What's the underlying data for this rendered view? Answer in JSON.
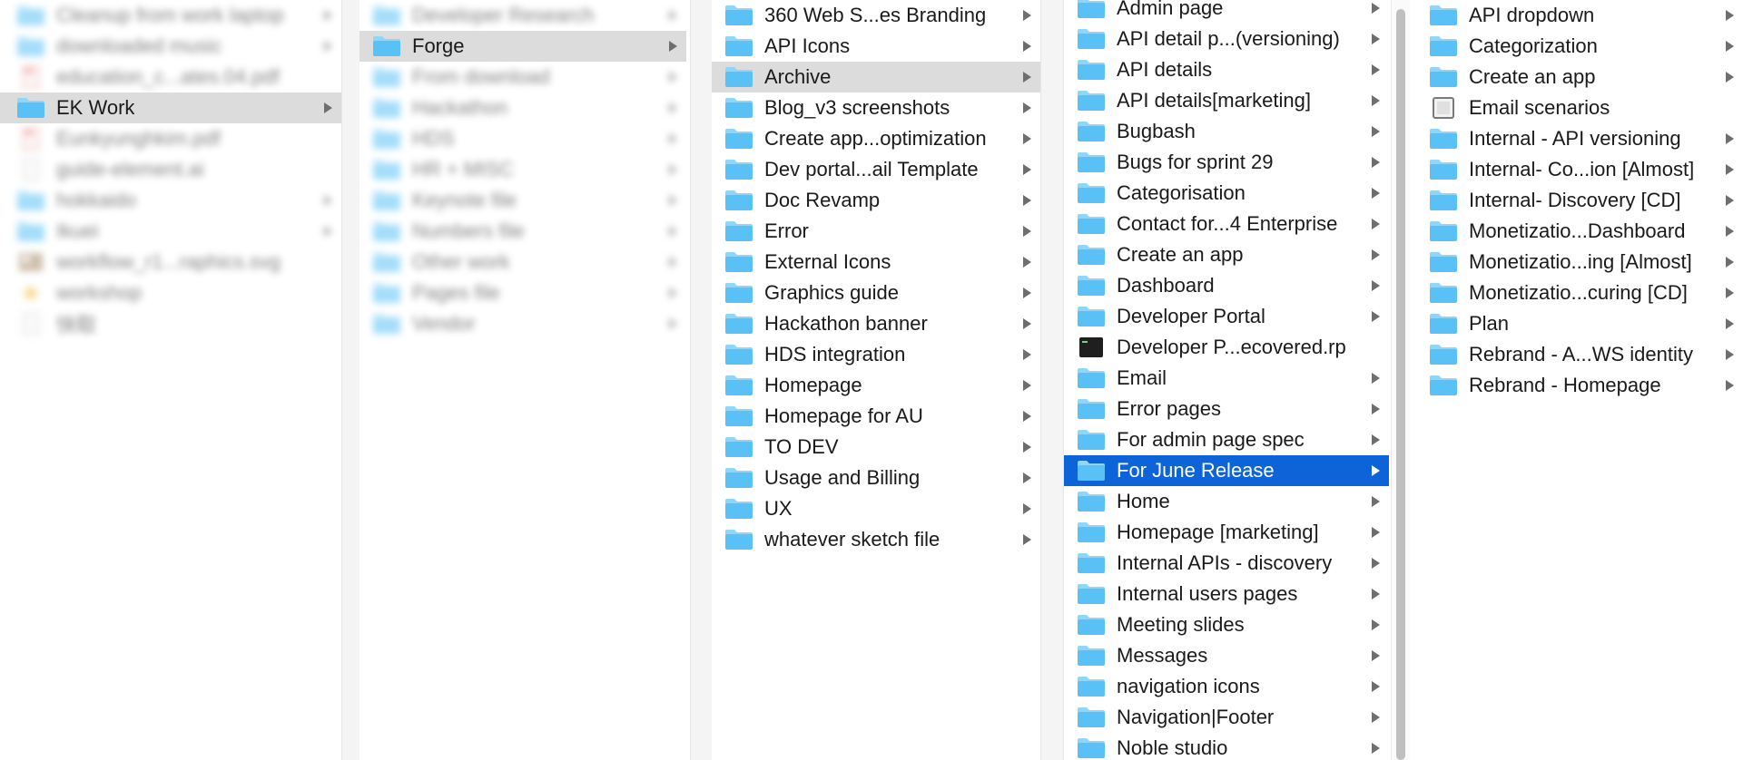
{
  "window": {
    "column1": {
      "items": [
        {
          "label": "Cleanup from work laptop",
          "icon": "folder-icon",
          "has_arrow": true,
          "state": "blur"
        },
        {
          "label": "downloaded music",
          "icon": "folder-icon",
          "has_arrow": true,
          "state": "blur"
        },
        {
          "label": "education_c...ates.04.pdf",
          "icon": "pdf-icon",
          "has_arrow": false,
          "state": "blur"
        },
        {
          "label": "EK Work",
          "icon": "folder-icon",
          "has_arrow": true,
          "state": "selected-gray"
        },
        {
          "label": "Eunkyunghkim.pdf",
          "icon": "pdf-icon",
          "has_arrow": false,
          "state": "blur"
        },
        {
          "label": "guide-element.ai",
          "icon": "doc-icon",
          "has_arrow": false,
          "state": "blur"
        },
        {
          "label": "hokkaido",
          "icon": "folder-icon",
          "has_arrow": true,
          "state": "blur"
        },
        {
          "label": "Ikuei",
          "icon": "folder-icon",
          "has_arrow": true,
          "state": "blur"
        },
        {
          "label": "workflow_r1...raphics.svg",
          "icon": "image-icon",
          "has_arrow": false,
          "state": "blur"
        },
        {
          "label": "workshop",
          "icon": "star-icon",
          "has_arrow": false,
          "state": "blur"
        },
        {
          "label": "快取",
          "icon": "doc-icon",
          "has_arrow": false,
          "state": "blur"
        }
      ]
    },
    "column2": {
      "items": [
        {
          "label": "Developer Research",
          "icon": "folder-icon",
          "has_arrow": true,
          "state": "blur"
        },
        {
          "label": "Forge",
          "icon": "folder-icon",
          "has_arrow": true,
          "state": "selected-gray"
        },
        {
          "label": "From download",
          "icon": "folder-icon",
          "has_arrow": true,
          "state": "blur"
        },
        {
          "label": "Hackathon",
          "icon": "folder-icon",
          "has_arrow": true,
          "state": "blur"
        },
        {
          "label": "HDS",
          "icon": "folder-icon",
          "has_arrow": true,
          "state": "blur"
        },
        {
          "label": "HR + MISC",
          "icon": "folder-icon",
          "has_arrow": true,
          "state": "blur"
        },
        {
          "label": "Keynote file",
          "icon": "folder-icon",
          "has_arrow": true,
          "state": "blur"
        },
        {
          "label": "Numbers file",
          "icon": "folder-icon",
          "has_arrow": true,
          "state": "blur"
        },
        {
          "label": "Other work",
          "icon": "folder-icon",
          "has_arrow": true,
          "state": "blur"
        },
        {
          "label": "Pages file",
          "icon": "folder-icon",
          "has_arrow": true,
          "state": "blur"
        },
        {
          "label": "Vendor",
          "icon": "folder-icon",
          "has_arrow": true,
          "state": "blur"
        }
      ]
    },
    "column3": {
      "items": [
        {
          "label": "360 Web S...es Branding",
          "icon": "folder-icon",
          "has_arrow": true,
          "state": "normal"
        },
        {
          "label": "API Icons",
          "icon": "folder-icon",
          "has_arrow": true,
          "state": "normal"
        },
        {
          "label": "Archive",
          "icon": "folder-icon",
          "has_arrow": true,
          "state": "selected-gray"
        },
        {
          "label": "Blog_v3 screenshots",
          "icon": "folder-icon",
          "has_arrow": true,
          "state": "normal"
        },
        {
          "label": "Create app...optimization",
          "icon": "folder-icon",
          "has_arrow": true,
          "state": "normal"
        },
        {
          "label": "Dev portal...ail Template",
          "icon": "folder-icon",
          "has_arrow": true,
          "state": "normal"
        },
        {
          "label": "Doc Revamp",
          "icon": "folder-icon",
          "has_arrow": true,
          "state": "normal"
        },
        {
          "label": "Error",
          "icon": "folder-icon",
          "has_arrow": true,
          "state": "normal"
        },
        {
          "label": "External Icons",
          "icon": "folder-icon",
          "has_arrow": true,
          "state": "normal"
        },
        {
          "label": "Graphics guide",
          "icon": "folder-icon",
          "has_arrow": true,
          "state": "normal"
        },
        {
          "label": "Hackathon banner",
          "icon": "folder-icon",
          "has_arrow": true,
          "state": "normal"
        },
        {
          "label": "HDS integration",
          "icon": "folder-icon",
          "has_arrow": true,
          "state": "normal"
        },
        {
          "label": "Homepage",
          "icon": "folder-icon",
          "has_arrow": true,
          "state": "normal"
        },
        {
          "label": "Homepage for AU",
          "icon": "folder-icon",
          "has_arrow": true,
          "state": "normal"
        },
        {
          "label": "TO DEV",
          "icon": "folder-icon",
          "has_arrow": true,
          "state": "normal"
        },
        {
          "label": "Usage and Billing",
          "icon": "folder-icon",
          "has_arrow": true,
          "state": "normal"
        },
        {
          "label": "UX",
          "icon": "folder-icon",
          "has_arrow": true,
          "state": "normal"
        },
        {
          "label": "whatever sketch file",
          "icon": "folder-icon",
          "has_arrow": true,
          "state": "normal"
        }
      ]
    },
    "column4": {
      "items": [
        {
          "label": "Admin page",
          "icon": "folder-icon",
          "has_arrow": true,
          "state": "normal"
        },
        {
          "label": "API detail p...(versioning)",
          "icon": "folder-icon",
          "has_arrow": true,
          "state": "normal"
        },
        {
          "label": "API details",
          "icon": "folder-icon",
          "has_arrow": true,
          "state": "normal"
        },
        {
          "label": "API details[marketing]",
          "icon": "folder-icon",
          "has_arrow": true,
          "state": "normal"
        },
        {
          "label": "Bugbash",
          "icon": "folder-icon",
          "has_arrow": true,
          "state": "normal"
        },
        {
          "label": "Bugs for sprint 29",
          "icon": "folder-icon",
          "has_arrow": true,
          "state": "normal"
        },
        {
          "label": "Categorisation",
          "icon": "folder-icon",
          "has_arrow": true,
          "state": "normal"
        },
        {
          "label": "Contact for...4 Enterprise",
          "icon": "folder-icon",
          "has_arrow": true,
          "state": "normal"
        },
        {
          "label": "Create an app",
          "icon": "folder-icon",
          "has_arrow": true,
          "state": "normal"
        },
        {
          "label": "Dashboard",
          "icon": "folder-icon",
          "has_arrow": true,
          "state": "normal"
        },
        {
          "label": "Developer Portal",
          "icon": "folder-icon",
          "has_arrow": true,
          "state": "normal"
        },
        {
          "label": "Developer P...ecovered.rp",
          "icon": "terminal-icon",
          "has_arrow": false,
          "state": "normal"
        },
        {
          "label": "Email",
          "icon": "folder-icon",
          "has_arrow": true,
          "state": "normal"
        },
        {
          "label": "Error pages",
          "icon": "folder-icon",
          "has_arrow": true,
          "state": "normal"
        },
        {
          "label": "For admin page spec",
          "icon": "folder-icon",
          "has_arrow": true,
          "state": "normal"
        },
        {
          "label": "For June Release",
          "icon": "folder-icon",
          "has_arrow": true,
          "state": "selected-blue"
        },
        {
          "label": "Home",
          "icon": "folder-icon",
          "has_arrow": true,
          "state": "normal"
        },
        {
          "label": "Homepage [marketing]",
          "icon": "folder-icon",
          "has_arrow": true,
          "state": "normal"
        },
        {
          "label": "Internal APIs - discovery",
          "icon": "folder-icon",
          "has_arrow": true,
          "state": "normal"
        },
        {
          "label": "Internal users pages",
          "icon": "folder-icon",
          "has_arrow": true,
          "state": "normal"
        },
        {
          "label": "Meeting slides",
          "icon": "folder-icon",
          "has_arrow": true,
          "state": "normal"
        },
        {
          "label": "Messages",
          "icon": "folder-icon",
          "has_arrow": true,
          "state": "normal"
        },
        {
          "label": "navigation icons",
          "icon": "folder-icon",
          "has_arrow": true,
          "state": "normal"
        },
        {
          "label": "Navigation|Footer",
          "icon": "folder-icon",
          "has_arrow": true,
          "state": "normal"
        },
        {
          "label": "Noble studio",
          "icon": "folder-icon",
          "has_arrow": true,
          "state": "normal"
        }
      ]
    },
    "column5": {
      "items": [
        {
          "label": "API dropdown",
          "icon": "folder-icon",
          "has_arrow": true,
          "state": "normal"
        },
        {
          "label": "Categorization",
          "icon": "folder-icon",
          "has_arrow": true,
          "state": "normal"
        },
        {
          "label": "Create an app",
          "icon": "folder-icon",
          "has_arrow": true,
          "state": "normal"
        },
        {
          "label": "Email scenarios",
          "icon": "file-icon",
          "has_arrow": false,
          "state": "normal"
        },
        {
          "label": "Internal - API versioning",
          "icon": "folder-icon",
          "has_arrow": true,
          "state": "normal"
        },
        {
          "label": "Internal- Co...ion [Almost]",
          "icon": "folder-icon",
          "has_arrow": true,
          "state": "normal"
        },
        {
          "label": "Internal- Discovery [CD]",
          "icon": "folder-icon",
          "has_arrow": true,
          "state": "normal"
        },
        {
          "label": "Monetizatio...Dashboard",
          "icon": "folder-icon",
          "has_arrow": true,
          "state": "normal"
        },
        {
          "label": "Monetizatio...ing [Almost]",
          "icon": "folder-icon",
          "has_arrow": true,
          "state": "normal"
        },
        {
          "label": "Monetizatio...curing [CD]",
          "icon": "folder-icon",
          "has_arrow": true,
          "state": "normal"
        },
        {
          "label": "Plan",
          "icon": "folder-icon",
          "has_arrow": true,
          "state": "normal"
        },
        {
          "label": "Rebrand - A...WS identity",
          "icon": "folder-icon",
          "has_arrow": true,
          "state": "normal"
        },
        {
          "label": "Rebrand - Homepage",
          "icon": "folder-icon",
          "has_arrow": true,
          "state": "normal"
        }
      ]
    }
  },
  "colors": {
    "folder": "#5ac1f6",
    "folder_tab": "#8fd6fb",
    "selection_blue": "#0d63d8",
    "selection_gray": "#dcdcdc",
    "text": "#1a1a1a"
  }
}
